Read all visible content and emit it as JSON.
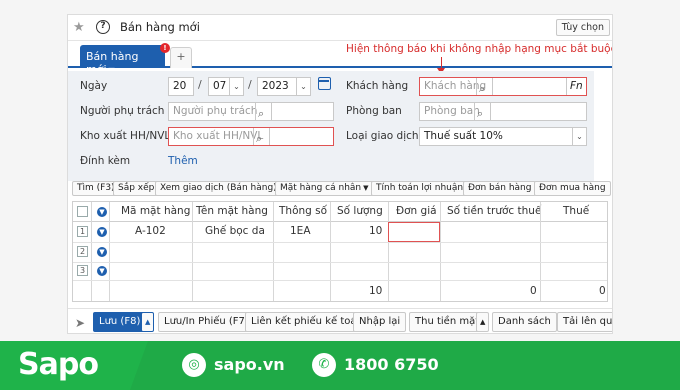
{
  "window": {
    "title": "Bán hàng mới",
    "options_label": "Tùy chọn",
    "tab_label": "Bán hàng mới",
    "tab_badge": "!",
    "add_tab": "+"
  },
  "annotation": "Hiện thông báo khi không nhập hạng mục bắt buộc",
  "form": {
    "date_label": "Ngày",
    "date_day": "20",
    "date_month": "07",
    "date_year": "2023",
    "staff_label": "Người phụ trách",
    "staff_placeholder": "Người phụ trách",
    "warehouse_label": "Kho xuất HH/NVL",
    "warehouse_placeholder": "Kho xuất HH/NVL",
    "attach_label": "Đính kèm",
    "attach_link": "Thêm",
    "customer_label": "Khách hàng",
    "customer_placeholder": "Khách hàng",
    "customer_fn": "Fn",
    "dept_label": "Phòng ban",
    "dept_placeholder": "Phòng ban",
    "txtype_label": "Loại giao dịch",
    "txtype_value": "Thuế suất 10%"
  },
  "toolbar": [
    "Tìm (F3)",
    "Sắp xếp",
    "Xem giao dịch (Bán hàng)",
    "Mặt hàng cá nhân",
    "Tính toán lợi nhuận",
    "Đơn bán hàng",
    "Đơn mua hàng"
  ],
  "grid": {
    "headers": [
      "Mã mặt hàng",
      "Tên mặt hàng",
      "Thông số",
      "Số lượng",
      "Đơn giá",
      "Số tiền trước thuế",
      "Thuế"
    ],
    "rows": [
      {
        "num": "1",
        "code": "A-102",
        "name": "Ghế bọc da",
        "spec": "1EA",
        "qty": "10",
        "price": "",
        "amount": "",
        "tax": ""
      },
      {
        "num": "2",
        "code": "",
        "name": "",
        "spec": "",
        "qty": "",
        "price": "",
        "amount": "",
        "tax": ""
      },
      {
        "num": "3",
        "code": "",
        "name": "",
        "spec": "",
        "qty": "",
        "price": "",
        "amount": "",
        "tax": ""
      }
    ],
    "totals": {
      "qty": "10",
      "amount": "0",
      "tax": "0"
    }
  },
  "bottom": {
    "save": "Lưu (F8)",
    "save_print": "Lưu/In Phiếu (F7)",
    "link_accounting": "Liên kết phiếu kế toán",
    "reenter": "Nhập lại",
    "collect": "Thu tiền mặt",
    "list": "Danh sách",
    "upload": "Tải lên qua"
  },
  "footer": {
    "brand": "Sapo",
    "website": "sapo.vn",
    "phone": "1800 6750"
  },
  "colors": {
    "accent": "#1e5fae",
    "alert": "#d72d2d",
    "brand_green": "#1fb34a"
  }
}
